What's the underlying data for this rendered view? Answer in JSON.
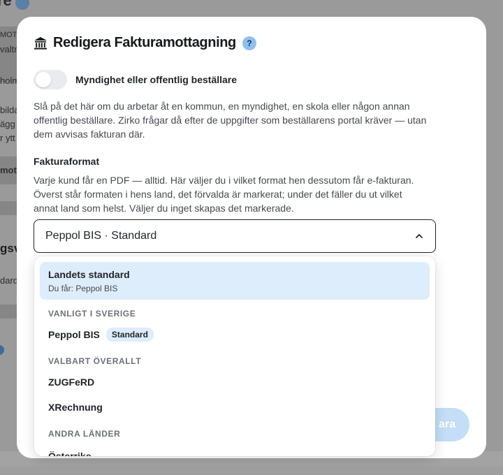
{
  "background": {
    "title_fragment": "re",
    "fragments": [
      "MOTT",
      "valtn",
      "holm",
      "bilda",
      "ägg",
      "r ytt",
      "mot",
      "gsv",
      "dard"
    ]
  },
  "modal": {
    "title": "Redigera Fakturamottagning",
    "help_label": "?",
    "toggle": {
      "label": "Myndighet eller offentlig beställare",
      "on": false
    },
    "public_description": "Slå på det här om du arbetar åt en kommun, en myndighet, en skola eller någon annan offentlig beställare. Zirko frågar då efter de uppgifter som beställarens portal kräver — utan dem avvisas fakturan där.",
    "format_label": "Fakturaformat",
    "format_description": "Varje kund får en PDF — alltid. Här väljer du i vilket format hen dessutom får e-fakturan. Överst står formaten i hens land, det förvalda är markerat; under det fäller du ut vilket annat land som helst. Väljer du inget skapas det markerade.",
    "select_value": "Peppol BIS · Standard",
    "save_fragment": "ara"
  },
  "dropdown": {
    "highlighted": {
      "title": "Landets standard",
      "subtitle": "Du får: Peppol BIS"
    },
    "group_sweden": "VANLIGT I SVERIGE",
    "opt_peppol": "Peppol BIS",
    "opt_peppol_badge": "Standard",
    "group_everywhere": "VALBART ÖVERALLT",
    "opt_zugferd": "ZUGFeRD",
    "opt_xrechnung": "XRechnung",
    "group_other": "ANDRA LÄNDER",
    "opt_cut": "Österrike"
  },
  "colors": {
    "accent": "#8ec0ef",
    "highlight": "#deedfb",
    "text": "#1f2329"
  }
}
